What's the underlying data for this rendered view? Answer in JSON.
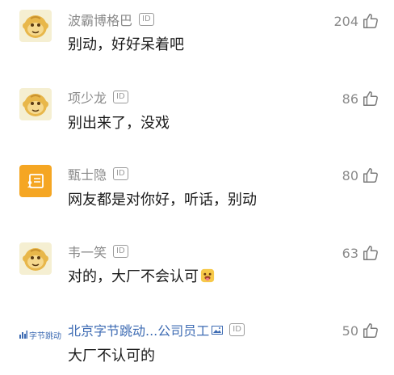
{
  "comments": [
    {
      "username": "波霸博格巴",
      "id_badge": "ID",
      "content": "别动，好好呆着吧",
      "likes": "204",
      "avatar_icon": "monkey-avatar-icon"
    },
    {
      "username": "项少龙",
      "id_badge": "ID",
      "content": "别出来了，没戏",
      "likes": "86",
      "avatar_icon": "monkey-avatar-icon"
    },
    {
      "username": "甄士隐",
      "id_badge": "ID",
      "content": "网友都是对你好，听话，别动",
      "likes": "80",
      "avatar_icon": "orange-id-card-avatar-icon"
    },
    {
      "username": "韦一笑",
      "id_badge": "ID",
      "content": "对的，大厂不会认可",
      "likes": "63",
      "avatar_icon": "monkey-avatar-icon",
      "emoji": "tongue-out-emoji-icon"
    },
    {
      "username": "北京字节跳动...公司员工",
      "id_badge": "ID",
      "content": "大厂不认可的",
      "likes": "50",
      "avatar_logo_text": "字节跳动",
      "image_badge_icon": "image-icon"
    }
  ],
  "colors": {
    "username_gray": "#8a8a8a",
    "username_blue": "#3d6bb3",
    "content_text": "#1a1a1a",
    "monkey_bg": "#f7d86a",
    "orange_avatar": "#f5a623"
  }
}
